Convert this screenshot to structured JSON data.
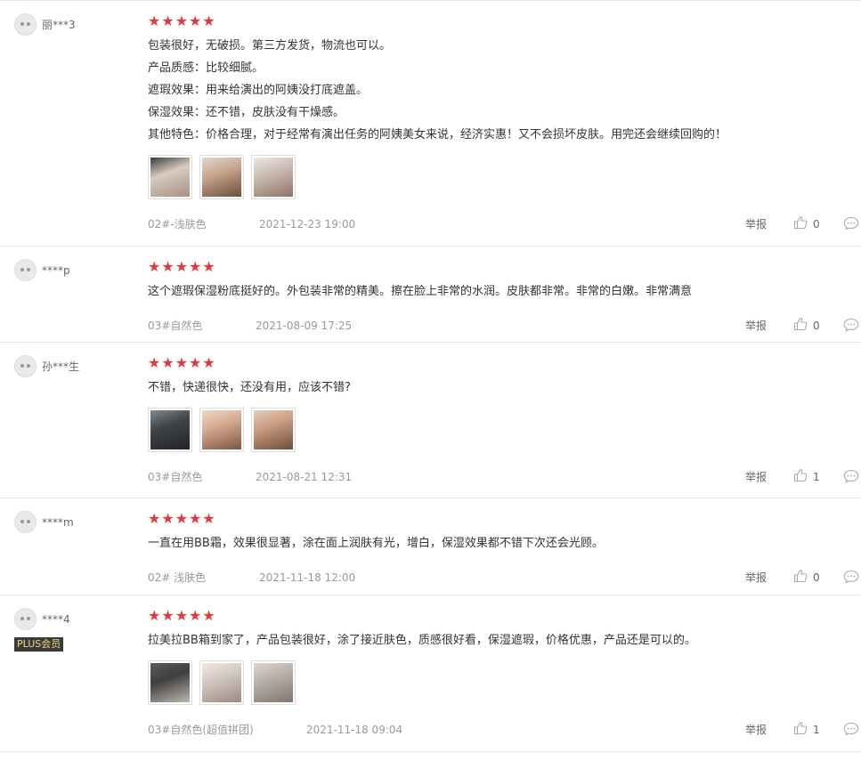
{
  "reviews": [
    {
      "user": "丽***3",
      "plus": false,
      "lines": [
        "包装很好，无破损。第三方发货，物流也可以。",
        "产品质感：比较细腻。",
        "遮瑕效果：用来给演出的阿姨没打底遮盖。",
        "保湿效果：还不错，皮肤没有干燥感。",
        "其他特色：价格合理，对于经常有演出任务的阿姨美女来说，经济实惠！又不会损坏皮肤。用完还会继续回购的！"
      ],
      "images": [
        "bb-cream-photo-1",
        "bb-cream-photo-2",
        "bb-cream-photo-3"
      ],
      "spec": "02#-浅肤色",
      "time": "2021-12-23 19:00",
      "report": "举报",
      "likes": "0"
    },
    {
      "user": "****p",
      "plus": false,
      "lines": [
        "这个遮瑕保湿粉底挺好的。外包装非常的精美。擦在脸上非常的水润。皮肤都非常。非常的白嫩。非常满意"
      ],
      "images": [],
      "spec": "03#自然色",
      "time": "2021-08-09 17:25",
      "report": "举报",
      "likes": "0"
    },
    {
      "user": "孙***生",
      "plus": false,
      "lines": [
        "不错，快递很快，还没有用，应该不错?"
      ],
      "images": [
        "bb-box-photo",
        "bb-bottle-photo-1",
        "bb-bottle-photo-2"
      ],
      "spec": "03#自然色",
      "time": "2021-08-21 12:31",
      "report": "举报",
      "likes": "1"
    },
    {
      "user": "****m",
      "plus": false,
      "lines": [
        "一直在用BB霜，效果很显著，涂在面上润肤有光，增白，保湿效果都不错下次还会光顾。"
      ],
      "images": [],
      "spec": "02# 浅肤色",
      "time": "2021-11-18 12:00",
      "report": "举报",
      "likes": "0"
    },
    {
      "user": "****4",
      "plus": true,
      "plus_label": "PLUS会员",
      "lines": [
        "拉美拉BB箱到家了，产品包装很好，涂了接近肤色，质感很好看，保湿遮瑕，价格优惠，产品还是可以的。"
      ],
      "images": [
        "bb-box-photo-2",
        "bb-bottle-photo-3",
        "skin-swatch-photo"
      ],
      "spec": "03#自然色(超值拼团)",
      "time": "2021-11-18 09:04",
      "report": "举报",
      "likes": "1"
    }
  ],
  "stars_text": "★★★★★",
  "colors": {
    "star": "#e4393c",
    "plus_bg": "#3a3a3a",
    "plus_fg": "#f7d488"
  }
}
